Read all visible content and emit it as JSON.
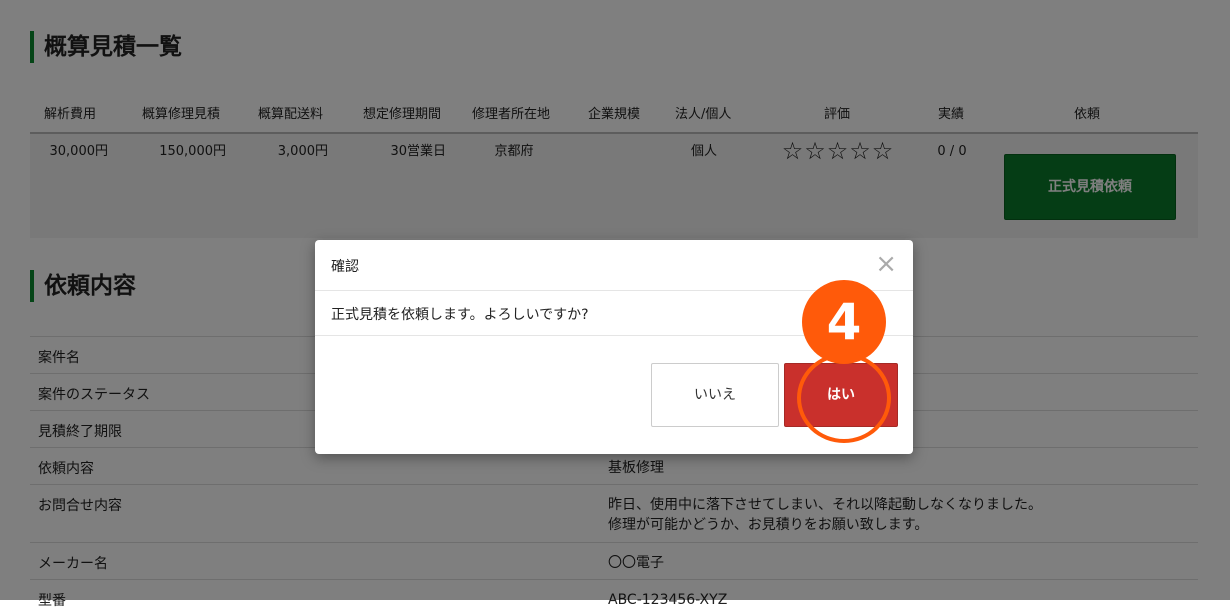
{
  "estimate": {
    "title": "概算見積一覧",
    "columns": [
      "解析費用",
      "概算修理見積",
      "概算配送料",
      "想定修理期間",
      "修理者所在地",
      "企業規模",
      "法人/個人",
      "評価",
      "実績",
      "依頼"
    ],
    "row": {
      "analysis_fee": "30,000円",
      "repair_estimate": "150,000円",
      "shipping": "3,000円",
      "period": "30営業日",
      "location": "京都府",
      "company_size": "",
      "entity_type": "個人",
      "rating_stars": "☆☆☆☆☆",
      "record": "0 / 0",
      "request_button": "正式見積依頼"
    }
  },
  "details": {
    "title": "依頼内容",
    "rows": [
      {
        "label": "案件名",
        "value": ""
      },
      {
        "label": "案件のステータス",
        "value": ""
      },
      {
        "label": "見積終了期限",
        "value": ""
      },
      {
        "label": "依頼内容",
        "value": "基板修理"
      },
      {
        "label": "お問合せ内容",
        "value_line1": "昨日、使用中に落下させてしまい、それ以降起動しなくなりました。",
        "value_line2": "修理が可能かどうか、お見積りをお願い致します。"
      },
      {
        "label": "メーカー名",
        "value": "〇〇電子"
      },
      {
        "label": "型番",
        "value": "ABC-123456-XYZ"
      }
    ]
  },
  "modal": {
    "title": "確認",
    "close_symbol": "×",
    "message": "正式見積を依頼します。よろしいですか?",
    "no_label": "いいえ",
    "yes_label": "はい"
  },
  "annotation": {
    "step_number": "4",
    "color": "#ff5a0a"
  }
}
